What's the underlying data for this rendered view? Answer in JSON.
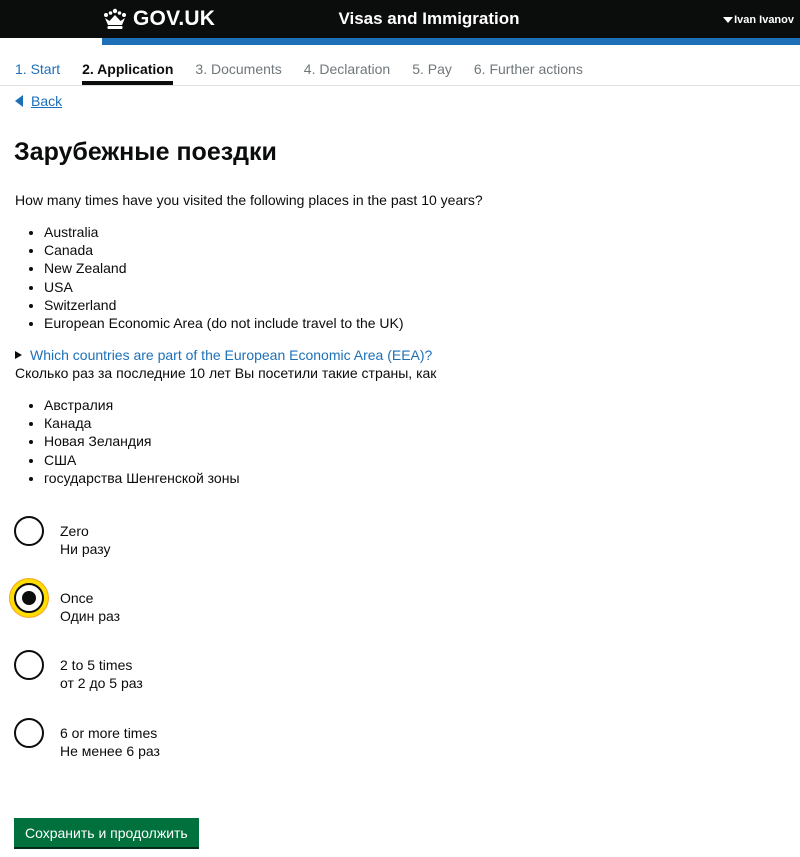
{
  "header": {
    "logo_text": "GOV.UK",
    "service_name": "Visas and Immigration",
    "user_name": "Ivan Ivanov"
  },
  "steps": [
    {
      "label": "1. Start",
      "state": "done"
    },
    {
      "label": "2. Application",
      "state": "current"
    },
    {
      "label": "3. Documents",
      "state": "todo"
    },
    {
      "label": "4. Declaration",
      "state": "todo"
    },
    {
      "label": "5. Pay",
      "state": "todo"
    },
    {
      "label": "6. Further actions",
      "state": "todo"
    }
  ],
  "back_label": "Back",
  "title": "Зарубежные поездки",
  "question_en": "How many times have you visited the following places in the past 10 years?",
  "places_en": [
    "Australia",
    "Canada",
    "New Zealand",
    "USA",
    "Switzerland",
    "European Economic Area (do not include travel to the UK)"
  ],
  "details_summary": "Which countries are part of the European Economic Area (EEA)?",
  "question_ru": "Сколько раз за последние 10 лет Вы посетили такие страны, как",
  "places_ru": [
    "Австралия",
    "Канада",
    "Новая Зеландия",
    "США",
    "государства Шенгенской зоны"
  ],
  "options": [
    {
      "en": "Zero",
      "ru": "Ни разу",
      "checked": false
    },
    {
      "en": "Once",
      "ru": "Один раз",
      "checked": true
    },
    {
      "en": "2 to 5 times",
      "ru": "от 2 до 5 раз",
      "checked": false
    },
    {
      "en": "6 or more times",
      "ru": "Не менее 6 раз",
      "checked": false
    }
  ],
  "submit_label": "Сохранить и продолжить",
  "colors": {
    "header": "#0b0c0c",
    "link": "#1d70b8",
    "button": "#00703c",
    "focus": "#ffdd00"
  }
}
